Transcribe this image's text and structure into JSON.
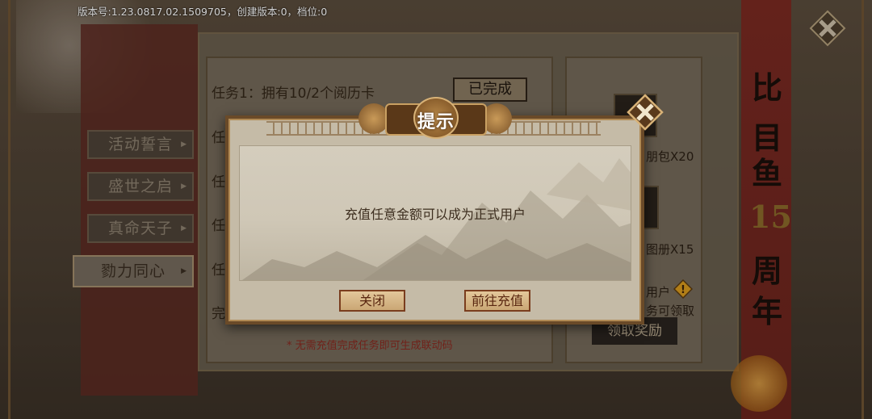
{
  "version_info": "版本号:1.23.0817.02.1509705，创建版本:0，档位:0",
  "side_menu": {
    "items": [
      {
        "label": "活动誓言",
        "active": false
      },
      {
        "label": "盛世之启",
        "active": false
      },
      {
        "label": "真命天子",
        "active": false
      },
      {
        "label": "勠力同心",
        "active": true
      }
    ]
  },
  "tasks": {
    "first": "任务1：拥有10/2个阅历卡",
    "first_status": "已完成",
    "partial_rows": [
      "任",
      "任",
      "任",
      "任",
      "完"
    ],
    "note": "* 无需充值完成任务即可生成联动码"
  },
  "rewards": {
    "item1_label": "朋包X20",
    "item2_label": "图册X15",
    "user_label": "用户",
    "task_label": "务可领取",
    "claim_button": "领取奖励"
  },
  "banner": {
    "lines": [
      "比",
      "目",
      "鱼",
      "15",
      "周",
      "年"
    ]
  },
  "dialog": {
    "title": "提示",
    "message": "充值任意金额可以成为正式用户",
    "close_button": "关闭",
    "recharge_button": "前往充值"
  },
  "colors": {
    "dialog_border": "#6a4a28",
    "button_text": "#5a2710",
    "banner_red": "#7a2a22"
  },
  "icons": [
    "close-x-icon",
    "warning-icon",
    "dragon-ornament-icon",
    "lantern-icon"
  ]
}
